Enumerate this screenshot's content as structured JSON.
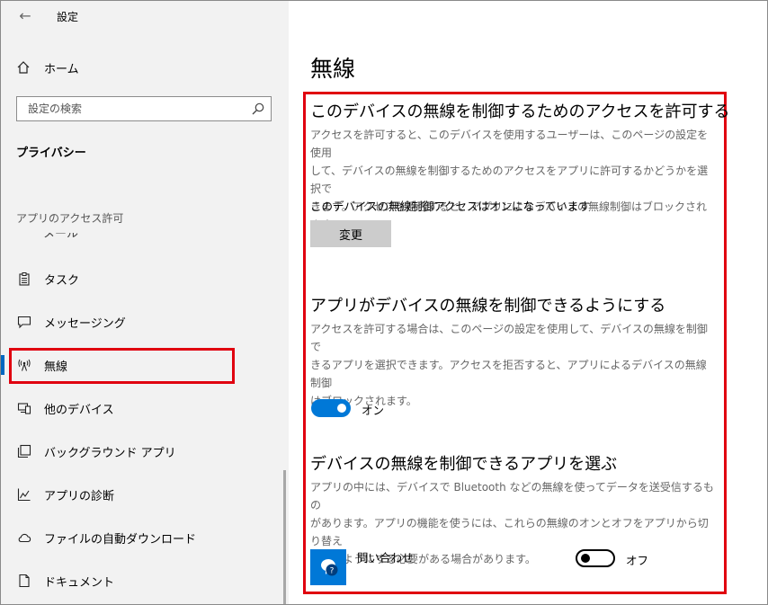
{
  "window": {
    "title": "設定",
    "back_icon": "arrow-left-icon"
  },
  "sidebar": {
    "home_label": "ホーム",
    "search": {
      "placeholder": "設定の検索"
    },
    "section_title": "プライバシー",
    "group_label": "アプリのアクセス許可",
    "partial_item_label": "メール",
    "items": [
      {
        "label": "タスク",
        "icon": "clipboard-icon"
      },
      {
        "label": "メッセージング",
        "icon": "chat-icon"
      },
      {
        "label": "無線",
        "icon": "antenna-icon",
        "selected": true
      },
      {
        "label": "他のデバイス",
        "icon": "devices-icon"
      },
      {
        "label": "バックグラウンド アプリ",
        "icon": "background-apps-icon"
      },
      {
        "label": "アプリの診断",
        "icon": "diagnostics-icon"
      },
      {
        "label": "ファイルの自動ダウンロード",
        "icon": "cloud-icon"
      },
      {
        "label": "ドキュメント",
        "icon": "document-icon"
      }
    ]
  },
  "main": {
    "title": "無線",
    "section1": {
      "heading": "このデバイスの無線を制御するためのアクセスを許可する",
      "desc_lines": [
        "アクセスを許可すると、このデバイスを使用するユーザーは、このページの設定を使用",
        "して、デバイスの無線を制御するためのアクセスをアプリに許可するかどうかを選択で",
        "きます。アクセスを拒否すると、アプリによるデバイスの無線制御はブロックされます。"
      ],
      "status": "このデバイスの無線制御アクセスはオンになっています",
      "button": "変更"
    },
    "section2": {
      "heading": "アプリがデバイスの無線を制御できるようにする",
      "desc_lines": [
        "アクセスを許可する場合は、このページの設定を使用して、デバイスの無線を制御で",
        "きるアプリを選択できます。アクセスを拒否すると、アプリによるデバイスの無線制御",
        "はブロックされます。"
      ],
      "toggle_label": "オン",
      "toggle_on": true
    },
    "section3": {
      "heading": "デバイスの無線を制御できるアプリを選ぶ",
      "desc_lines": [
        "アプリの中には、デバイスで Bluetooth などの無線を使ってデータを送受信するもの",
        "があります。アプリの機能を使うには、これらの無線のオンとオフをアプリから切り替え",
        "られるようにする必要がある場合があります。"
      ],
      "app": {
        "name": "問い合わせ",
        "icon": "get-help-icon",
        "toggle_label": "オフ",
        "toggle_on": false
      }
    }
  },
  "colors": {
    "accent": "#0078d7",
    "highlight": "#e0000f",
    "sidebar_bg": "#f2f2f2"
  }
}
